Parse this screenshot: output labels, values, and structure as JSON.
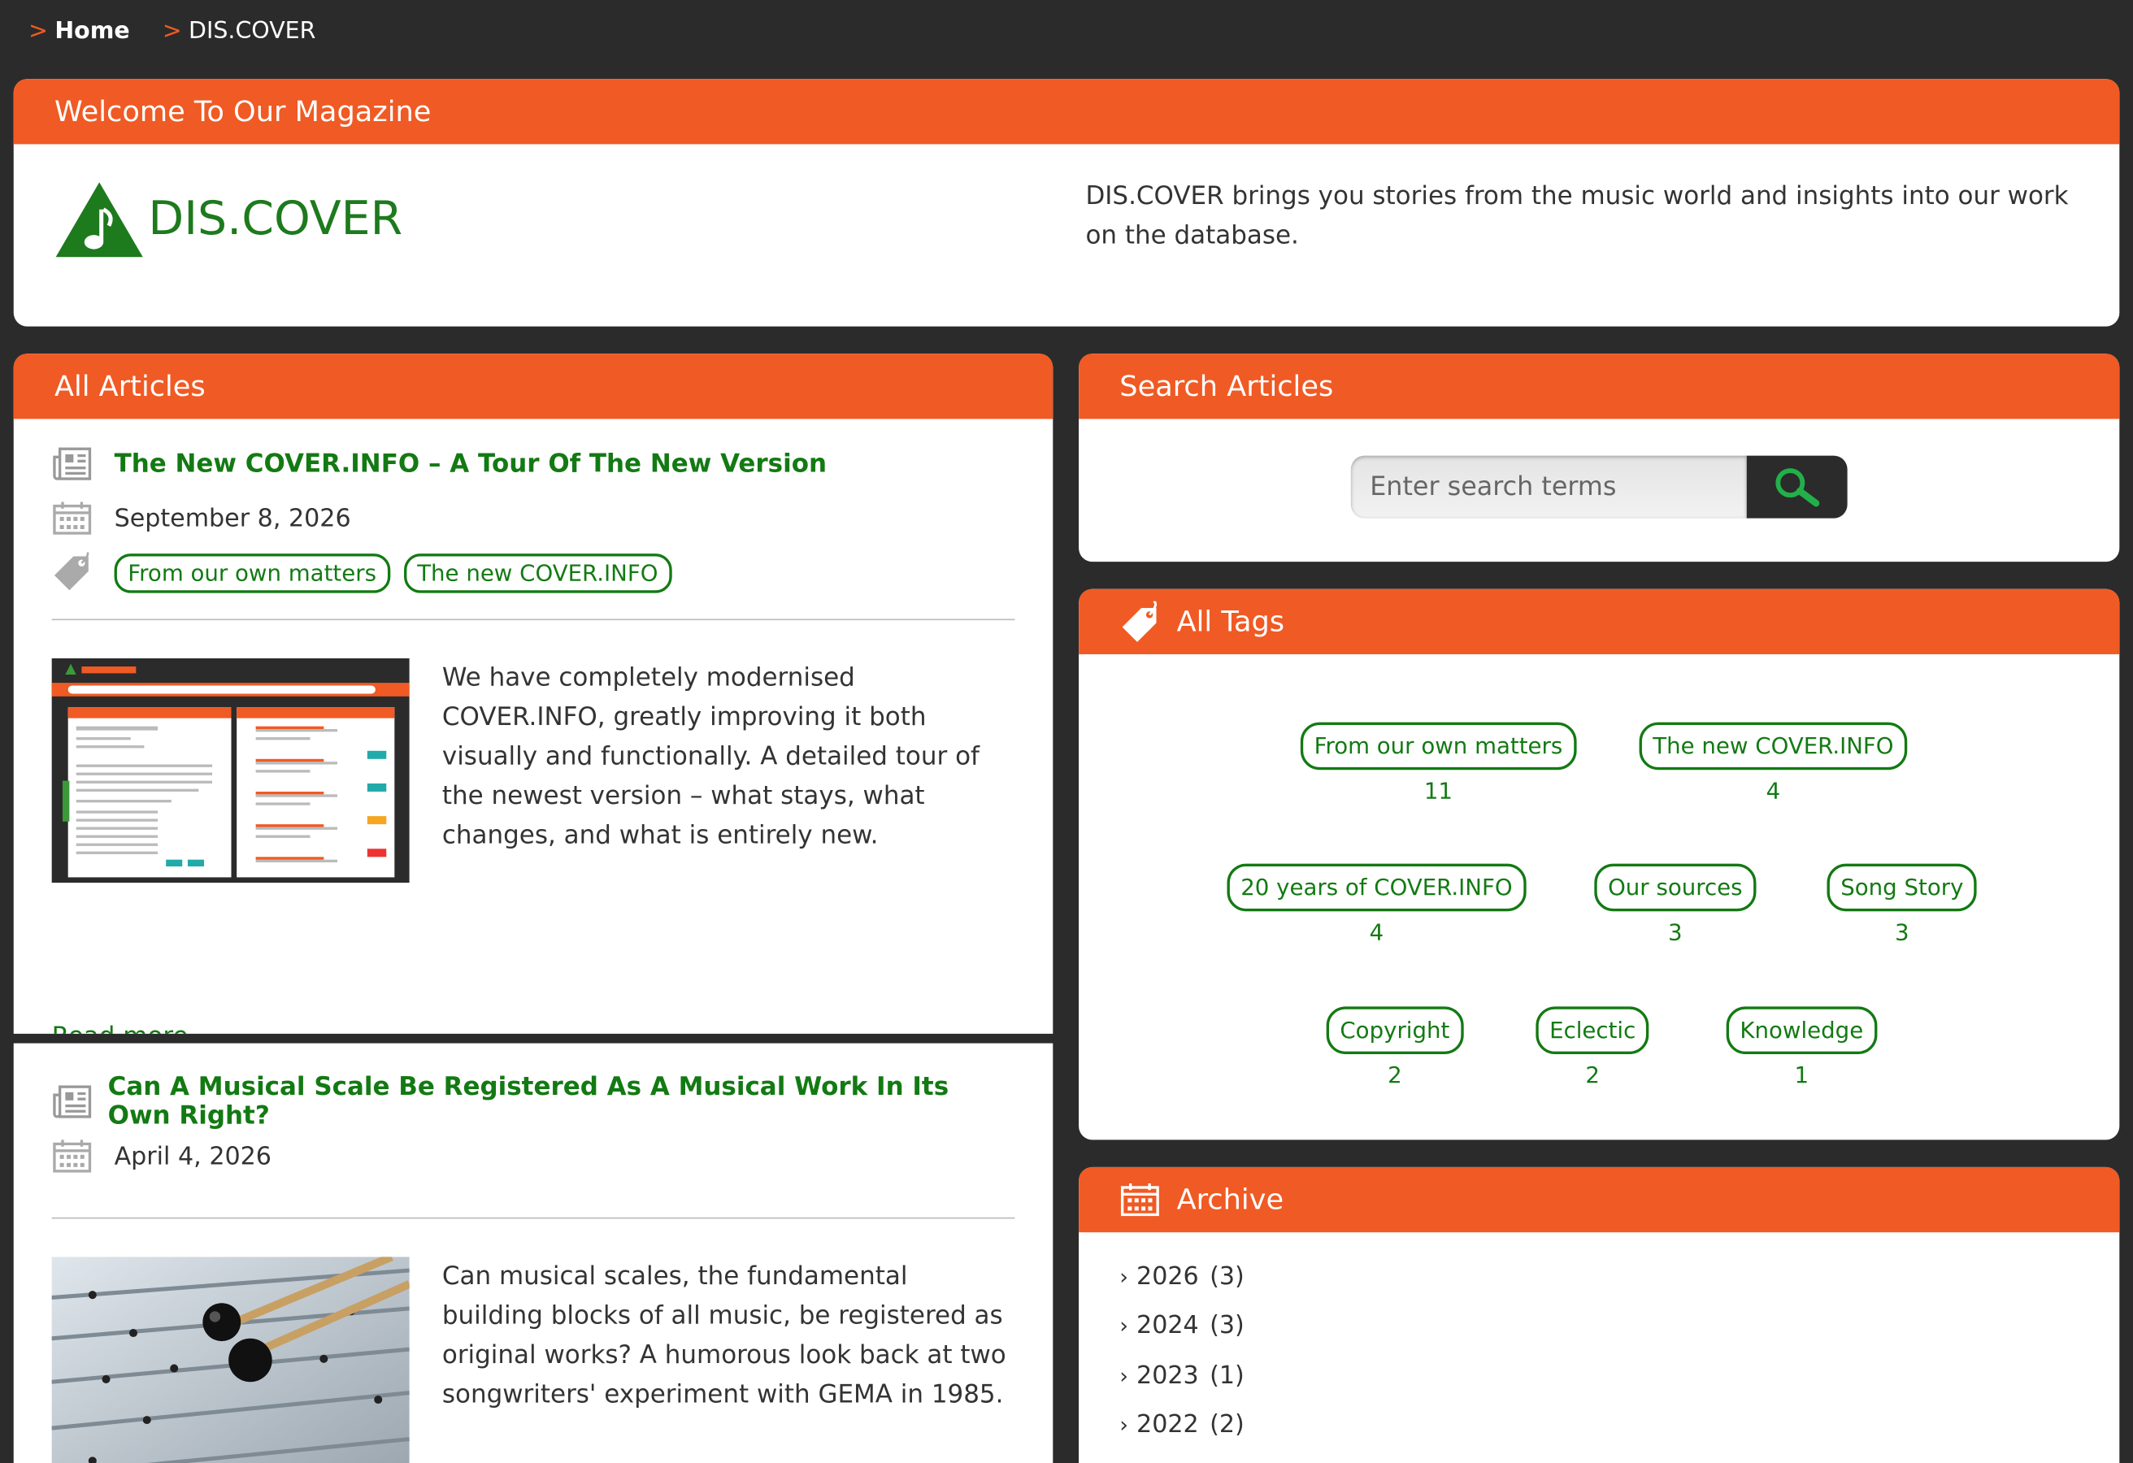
{
  "breadcrumb": [
    {
      "label": "Home"
    },
    {
      "label": "DIS.COVER"
    }
  ],
  "welcome": {
    "heading": "Welcome To Our Magazine",
    "logo_text": "DIS.COVER",
    "description": "DIS.COVER brings you stories from the music world and insights into our work on the database."
  },
  "articles_panel": {
    "heading": "All Articles",
    "items": [
      {
        "title": "The New COVER.INFO – A Tour Of The New Version",
        "date": "September 8, 2026",
        "tags": [
          "From our own matters",
          "The new COVER.INFO"
        ],
        "summary": "We have completely modernised COVER.INFO, greatly improving it both visually and functionally. A detailed tour of the newest version – what stays, what changes, and what is entirely new.",
        "read_more": "Read more..."
      },
      {
        "title": "Can A Musical Scale Be Registered As A Musical Work In Its Own Right?",
        "date": "April 4, 2026",
        "summary": "Can musical scales, the fundamental building blocks of all music, be registered as original works? A humorous look back at two songwriters' experiment with GEMA in 1985."
      }
    ]
  },
  "search": {
    "heading": "Search Articles",
    "placeholder": "Enter search terms"
  },
  "tags_panel": {
    "heading": "All Tags",
    "tags": [
      {
        "label": "From our own matters",
        "count": "11"
      },
      {
        "label": "The new COVER.INFO",
        "count": "4"
      },
      {
        "label": "20 years of COVER.INFO",
        "count": "4"
      },
      {
        "label": "Our sources",
        "count": "3"
      },
      {
        "label": "Song Story",
        "count": "3"
      },
      {
        "label": "Copyright",
        "count": "2"
      },
      {
        "label": "Eclectic",
        "count": "2"
      },
      {
        "label": "Knowledge",
        "count": "1"
      }
    ]
  },
  "archive": {
    "heading": "Archive",
    "years": [
      {
        "year": "2026",
        "count": "(3)"
      },
      {
        "year": "2024",
        "count": "(3)"
      },
      {
        "year": "2023",
        "count": "(1)"
      },
      {
        "year": "2022",
        "count": "(2)"
      }
    ]
  },
  "colors": {
    "accent": "#f05a24",
    "link_green": "#137a13",
    "background": "#2b2b2b"
  }
}
